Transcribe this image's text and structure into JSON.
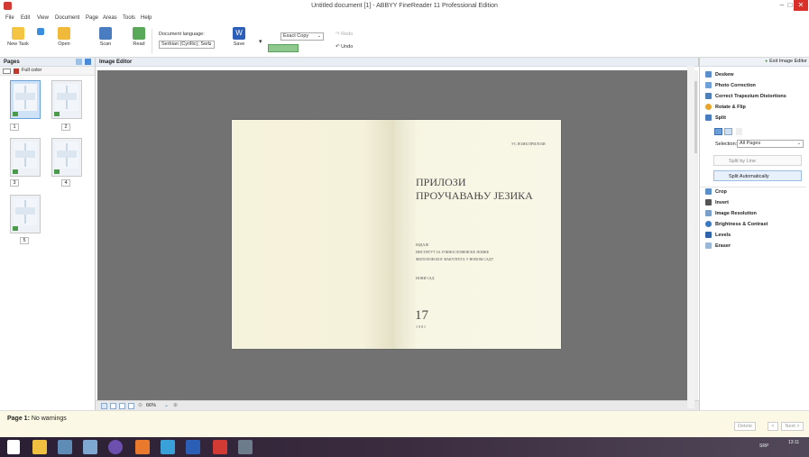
{
  "window": {
    "title": "Untitled document [1] - ABBYY FineReader 11 Professional Edition"
  },
  "menu": [
    "File",
    "Edit",
    "View",
    "Document",
    "Page",
    "Areas",
    "Tools",
    "Help"
  ],
  "toolbar": {
    "new_task": "New Task",
    "open": "Open",
    "scan": "Scan",
    "read": "Read",
    "doc_lang_label": "Document language:",
    "doc_lang_value": "Serbian (Cyrillic); Serb",
    "save": "Save",
    "format_value": "Exact Copy",
    "redo": "Redo",
    "undo": "Undo"
  },
  "pages_panel": {
    "title": "Pages",
    "color_mode": "Full color",
    "pages": [
      "1",
      "2",
      "3",
      "4",
      "5"
    ]
  },
  "editor": {
    "title": "Image Editor",
    "zoom": "66%",
    "book": {
      "header_right": "УС ЈЕЗИК ПРИЛОЗИ",
      "title_line1": "ПРИЛОЗИ",
      "title_line2": "ПРОУЧАВАЊУ  ЈЕЗИКА",
      "publisher_label": "ИЗДАЈЕ",
      "publisher_line1": "ИНСТИТУТ ЗА ЈУЖНОСЛОВЕНСКЕ ЈЕЗИКЕ",
      "publisher_line2": "ФИЛОЗОФСКОГ ФАКУЛТЕТА У НОВОМ САДУ",
      "city": "НОВИ САД",
      "volume": "17",
      "year": "1981"
    }
  },
  "right_panel": {
    "exit": "Exit Image Editor",
    "items_top": [
      "Deskew",
      "Photo Correction",
      "Correct Trapezium Distortions",
      "Rotate & Flip",
      "Split"
    ],
    "selection_label": "Selection:",
    "selection_value": "All Pages",
    "split_by_line": "Split by Line",
    "split_auto": "Split Automatically",
    "items_bottom": [
      "Crop",
      "Invert",
      "Image Resolution",
      "Brightness & Contrast",
      "Levels",
      "Eraser"
    ]
  },
  "status": {
    "page_label": "Page 1:",
    "message": "No warnings",
    "delete": "Delete",
    "prev": "<",
    "next": "Next >"
  },
  "taskbar": {
    "lang": "SRP",
    "time": "13:11"
  }
}
